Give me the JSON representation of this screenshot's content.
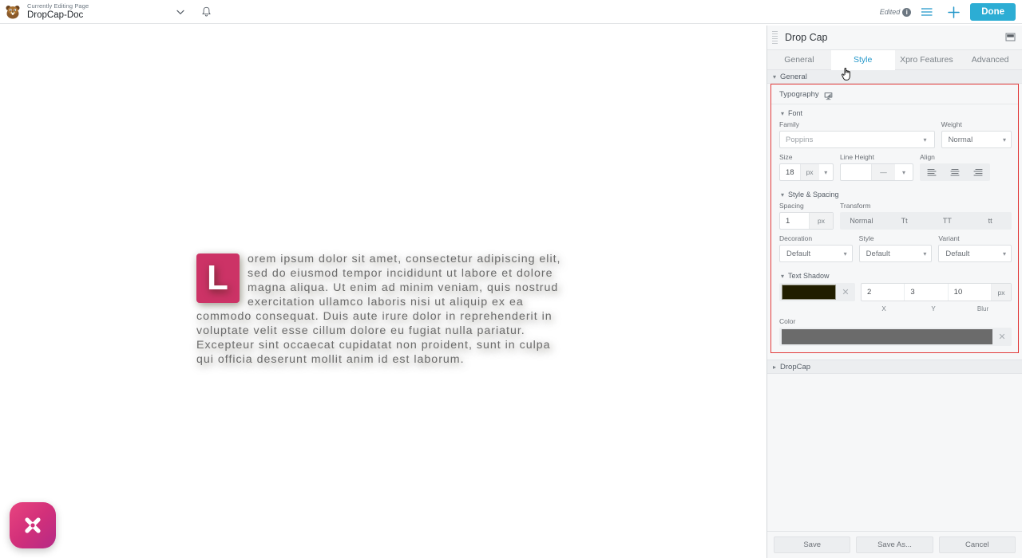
{
  "topbar": {
    "logo_icon": "beaver-logo-icon",
    "editing_label": "Currently Editing Page",
    "page_title": "DropCap-Doc",
    "chevron_icon": "chevron-down-icon",
    "bell_icon": "bell-icon",
    "edited_label": "Edited",
    "info_icon": "info-icon",
    "list_icon": "list-settings-icon",
    "plus_icon": "plus-icon",
    "done_label": "Done",
    "done_color": "#2cadd4"
  },
  "canvas": {
    "dropcap_letter": "L",
    "dropcap_bg": "#cc3366",
    "paragraph": "orem ipsum dolor sit amet, consectetur adipiscing elit, sed do eiusmod tempor incididunt ut labore et dolore magna aliqua. Ut enim ad minim veniam, quis nostrud exercitation ullamco laboris nisi ut aliquip ex ea commodo consequat. Duis aute irure dolor in reprehenderit in voluptate velit esse cillum dolore eu fugiat nulla pariatur. Excepteur sint occaecat cupidatat non proident, sunt in culpa qui officia deserunt mollit anim id est laborum.",
    "text_color": "#6b6b6b",
    "fab_icon": "xpro-x-logo-icon"
  },
  "panel": {
    "title": "Drop Cap",
    "dock_icon": "dock-window-icon",
    "grip_icon": "drag-grip-icon",
    "tabs": [
      {
        "label": "General",
        "active": false
      },
      {
        "label": "Style",
        "active": true
      },
      {
        "label": "Xpro Features",
        "active": false
      },
      {
        "label": "Advanced",
        "active": false
      }
    ],
    "general_section": {
      "label": "General",
      "caret": "⌄"
    },
    "typography": {
      "label": "Typography",
      "responsive_icon": "monitor-icon",
      "font_group": {
        "label": "Font",
        "family_label": "Family",
        "family_value": "Poppins",
        "weight_label": "Weight",
        "weight_value": "Normal",
        "size_label": "Size",
        "size_value": "18",
        "size_unit": "px",
        "line_height_label": "Line Height",
        "line_height_value": "",
        "line_height_unit": "—",
        "align_label": "Align",
        "align_options": [
          "align-left-icon",
          "align-center-icon",
          "align-right-icon"
        ]
      },
      "style_spacing_group": {
        "label": "Style & Spacing",
        "spacing_label": "Spacing",
        "spacing_value": "1",
        "spacing_unit": "px",
        "transform_label": "Transform",
        "transform_options": [
          "Normal",
          "Tt",
          "TT",
          "tt"
        ],
        "decoration_label": "Decoration",
        "decoration_value": "Default",
        "style_label": "Style",
        "style_value": "Default",
        "variant_label": "Variant",
        "variant_value": "Default"
      },
      "text_shadow_group": {
        "label": "Text Shadow",
        "color": "#211e00",
        "clear_icon": "clear-x-icon",
        "x_value": "2",
        "y_value": "3",
        "blur_value": "10",
        "unit": "px",
        "x_label": "X",
        "y_label": "Y",
        "blur_label": "Blur"
      },
      "color_group": {
        "label": "Color",
        "color": "#6b6b6b",
        "clear_icon": "clear-x-icon"
      }
    },
    "dropcap_section": {
      "label": "DropCap",
      "caret": "›"
    },
    "footer": {
      "save_label": "Save",
      "save_as_label": "Save As...",
      "cancel_label": "Cancel"
    }
  }
}
